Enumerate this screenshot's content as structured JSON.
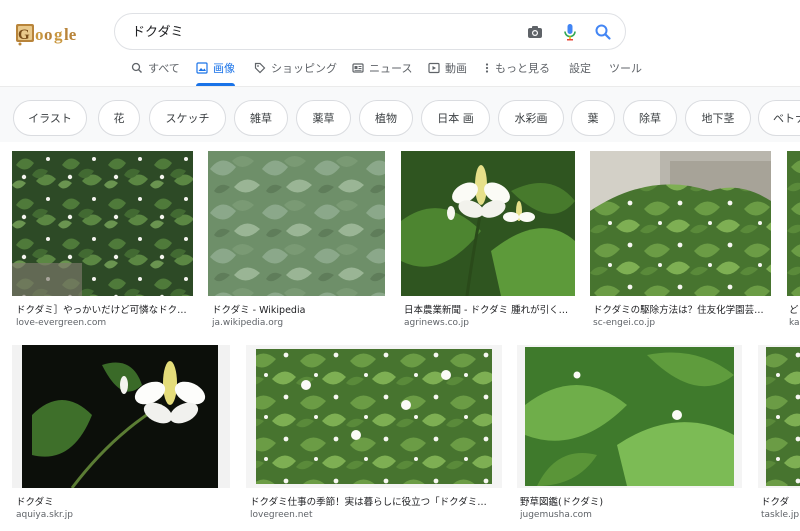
{
  "logo": {
    "text": "Google"
  },
  "search": {
    "query": "ドクダミ"
  },
  "tabs": [
    {
      "label": "すべて",
      "icon": "search-icon",
      "active": false
    },
    {
      "label": "画像",
      "icon": "image-icon",
      "active": true
    },
    {
      "label": "ショッピング",
      "icon": "tag-icon",
      "active": false
    },
    {
      "label": "ニュース",
      "icon": "news-icon",
      "active": false
    },
    {
      "label": "動画",
      "icon": "video-icon",
      "active": false
    },
    {
      "label": "もっと見る",
      "icon": "more-vert-icon",
      "active": false
    },
    {
      "label": "設定",
      "active": false
    },
    {
      "label": "ツール",
      "active": false
    }
  ],
  "chips": [
    "イラスト",
    "花",
    "スケッチ",
    "雑草",
    "薬草",
    "植物",
    "日本 画",
    "水彩画",
    "葉",
    "除草",
    "地下茎",
    "ベトナム"
  ],
  "results_row1": [
    {
      "caption": "ドクダミ］やっかいだけど可憐なドク…",
      "source": "love-evergreen.com"
    },
    {
      "caption": "ドクダミ - Wikipedia",
      "source": "ja.wikipedia.org"
    },
    {
      "caption": "日本農業新聞 - ドクダミ 腫れが引く…",
      "source": "agrinews.co.jp"
    },
    {
      "caption": "ドクダミの駆除方法は？住友化学園芸…",
      "source": "sc-engei.co.jp"
    },
    {
      "caption": "ど",
      "source": "ka"
    }
  ],
  "results_row2": [
    {
      "caption": "ドクダミ",
      "source": "aquiya.skr.jp"
    },
    {
      "caption": "ドクダミ仕事の季節！実は暮らしに役立つ「ドクダミ…",
      "source": "lovegreen.net"
    },
    {
      "caption": "野草図鑑(ドクダミ)",
      "source": "jugemusha.com"
    },
    {
      "caption": "ドクダ",
      "source": "taskle.jp"
    }
  ],
  "colors": {
    "accent": "#1a73e8",
    "muted": "#5f6368",
    "chip_border": "#dadce0",
    "leaf_dark": "#3f6b33",
    "leaf_light": "#7aa860"
  }
}
